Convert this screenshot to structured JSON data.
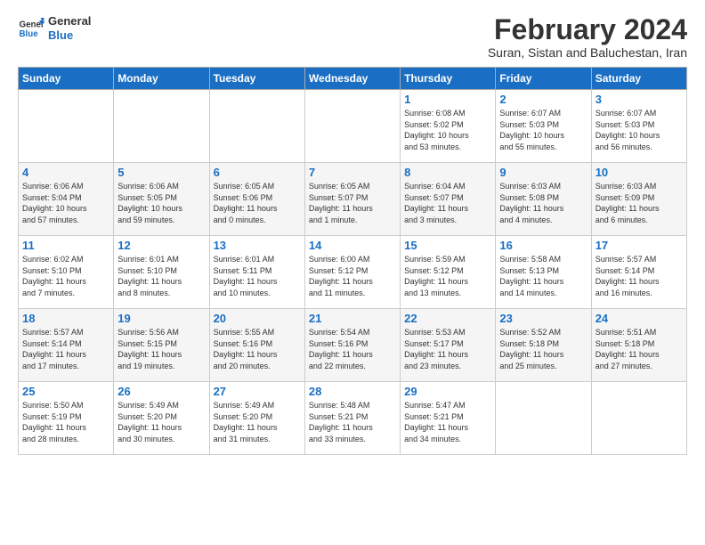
{
  "logo": {
    "line1": "General",
    "line2": "Blue"
  },
  "header": {
    "month": "February 2024",
    "location": "Suran, Sistan and Baluchestan, Iran"
  },
  "weekdays": [
    "Sunday",
    "Monday",
    "Tuesday",
    "Wednesday",
    "Thursday",
    "Friday",
    "Saturday"
  ],
  "weeks": [
    [
      {
        "day": "",
        "info": ""
      },
      {
        "day": "",
        "info": ""
      },
      {
        "day": "",
        "info": ""
      },
      {
        "day": "",
        "info": ""
      },
      {
        "day": "1",
        "info": "Sunrise: 6:08 AM\nSunset: 5:02 PM\nDaylight: 10 hours\nand 53 minutes."
      },
      {
        "day": "2",
        "info": "Sunrise: 6:07 AM\nSunset: 5:03 PM\nDaylight: 10 hours\nand 55 minutes."
      },
      {
        "day": "3",
        "info": "Sunrise: 6:07 AM\nSunset: 5:03 PM\nDaylight: 10 hours\nand 56 minutes."
      }
    ],
    [
      {
        "day": "4",
        "info": "Sunrise: 6:06 AM\nSunset: 5:04 PM\nDaylight: 10 hours\nand 57 minutes."
      },
      {
        "day": "5",
        "info": "Sunrise: 6:06 AM\nSunset: 5:05 PM\nDaylight: 10 hours\nand 59 minutes."
      },
      {
        "day": "6",
        "info": "Sunrise: 6:05 AM\nSunset: 5:06 PM\nDaylight: 11 hours\nand 0 minutes."
      },
      {
        "day": "7",
        "info": "Sunrise: 6:05 AM\nSunset: 5:07 PM\nDaylight: 11 hours\nand 1 minute."
      },
      {
        "day": "8",
        "info": "Sunrise: 6:04 AM\nSunset: 5:07 PM\nDaylight: 11 hours\nand 3 minutes."
      },
      {
        "day": "9",
        "info": "Sunrise: 6:03 AM\nSunset: 5:08 PM\nDaylight: 11 hours\nand 4 minutes."
      },
      {
        "day": "10",
        "info": "Sunrise: 6:03 AM\nSunset: 5:09 PM\nDaylight: 11 hours\nand 6 minutes."
      }
    ],
    [
      {
        "day": "11",
        "info": "Sunrise: 6:02 AM\nSunset: 5:10 PM\nDaylight: 11 hours\nand 7 minutes."
      },
      {
        "day": "12",
        "info": "Sunrise: 6:01 AM\nSunset: 5:10 PM\nDaylight: 11 hours\nand 8 minutes."
      },
      {
        "day": "13",
        "info": "Sunrise: 6:01 AM\nSunset: 5:11 PM\nDaylight: 11 hours\nand 10 minutes."
      },
      {
        "day": "14",
        "info": "Sunrise: 6:00 AM\nSunset: 5:12 PM\nDaylight: 11 hours\nand 11 minutes."
      },
      {
        "day": "15",
        "info": "Sunrise: 5:59 AM\nSunset: 5:12 PM\nDaylight: 11 hours\nand 13 minutes."
      },
      {
        "day": "16",
        "info": "Sunrise: 5:58 AM\nSunset: 5:13 PM\nDaylight: 11 hours\nand 14 minutes."
      },
      {
        "day": "17",
        "info": "Sunrise: 5:57 AM\nSunset: 5:14 PM\nDaylight: 11 hours\nand 16 minutes."
      }
    ],
    [
      {
        "day": "18",
        "info": "Sunrise: 5:57 AM\nSunset: 5:14 PM\nDaylight: 11 hours\nand 17 minutes."
      },
      {
        "day": "19",
        "info": "Sunrise: 5:56 AM\nSunset: 5:15 PM\nDaylight: 11 hours\nand 19 minutes."
      },
      {
        "day": "20",
        "info": "Sunrise: 5:55 AM\nSunset: 5:16 PM\nDaylight: 11 hours\nand 20 minutes."
      },
      {
        "day": "21",
        "info": "Sunrise: 5:54 AM\nSunset: 5:16 PM\nDaylight: 11 hours\nand 22 minutes."
      },
      {
        "day": "22",
        "info": "Sunrise: 5:53 AM\nSunset: 5:17 PM\nDaylight: 11 hours\nand 23 minutes."
      },
      {
        "day": "23",
        "info": "Sunrise: 5:52 AM\nSunset: 5:18 PM\nDaylight: 11 hours\nand 25 minutes."
      },
      {
        "day": "24",
        "info": "Sunrise: 5:51 AM\nSunset: 5:18 PM\nDaylight: 11 hours\nand 27 minutes."
      }
    ],
    [
      {
        "day": "25",
        "info": "Sunrise: 5:50 AM\nSunset: 5:19 PM\nDaylight: 11 hours\nand 28 minutes."
      },
      {
        "day": "26",
        "info": "Sunrise: 5:49 AM\nSunset: 5:20 PM\nDaylight: 11 hours\nand 30 minutes."
      },
      {
        "day": "27",
        "info": "Sunrise: 5:49 AM\nSunset: 5:20 PM\nDaylight: 11 hours\nand 31 minutes."
      },
      {
        "day": "28",
        "info": "Sunrise: 5:48 AM\nSunset: 5:21 PM\nDaylight: 11 hours\nand 33 minutes."
      },
      {
        "day": "29",
        "info": "Sunrise: 5:47 AM\nSunset: 5:21 PM\nDaylight: 11 hours\nand 34 minutes."
      },
      {
        "day": "",
        "info": ""
      },
      {
        "day": "",
        "info": ""
      }
    ]
  ]
}
